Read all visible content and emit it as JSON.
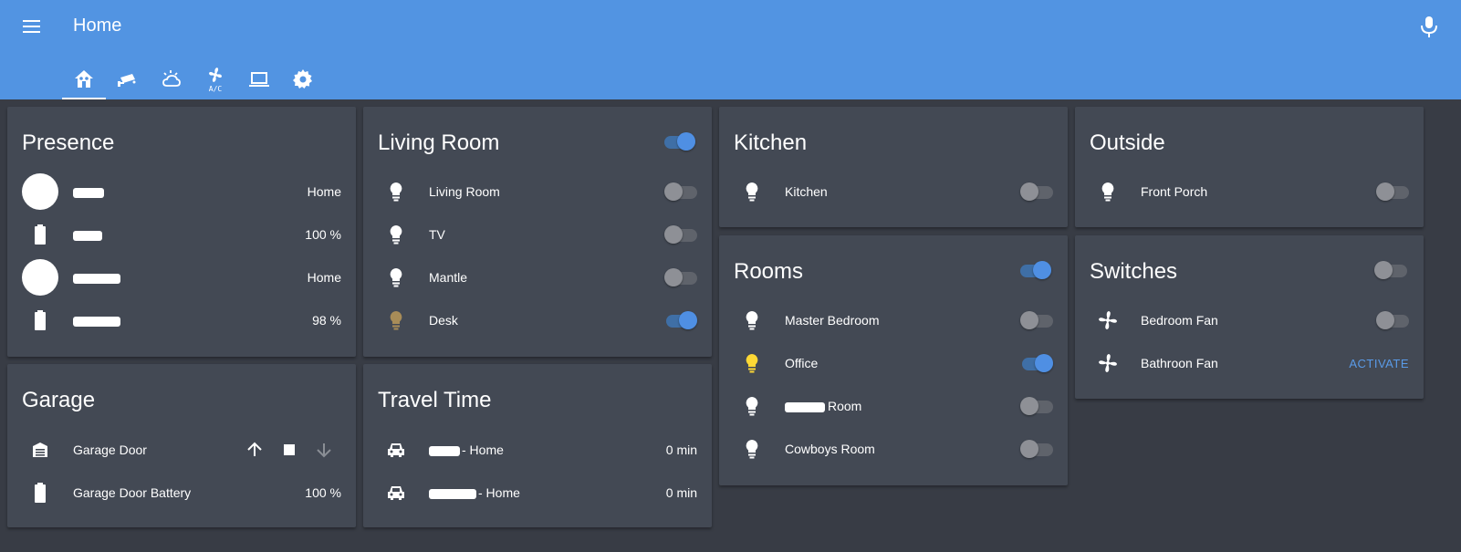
{
  "header": {
    "title": "Home",
    "tabs": [
      {
        "name": "home-icon"
      },
      {
        "name": "cctv-icon"
      },
      {
        "name": "weather-icon"
      },
      {
        "name": "ac-fan-icon",
        "label": "A/C"
      },
      {
        "name": "laptop-icon"
      },
      {
        "name": "gear-icon"
      }
    ]
  },
  "presence": {
    "title": "Presence",
    "rows": [
      {
        "value": "Home"
      },
      {
        "value": "100 %"
      },
      {
        "value": "Home"
      },
      {
        "value": "98 %"
      }
    ]
  },
  "garage": {
    "title": "Garage",
    "door_label": "Garage Door",
    "battery_label": "Garage Door Battery",
    "battery_value": "100 %"
  },
  "living_room": {
    "title": "Living Room",
    "header_toggle": true,
    "rows": [
      {
        "label": "Living Room",
        "on": false
      },
      {
        "label": "TV",
        "on": false
      },
      {
        "label": "Mantle",
        "on": false
      },
      {
        "label": "Desk",
        "on": true
      }
    ]
  },
  "travel_time": {
    "title": "Travel Time",
    "rows": [
      {
        "label": "- Home",
        "value": "0 min"
      },
      {
        "label": "- Home",
        "value": "0 min"
      }
    ]
  },
  "kitchen": {
    "title": "Kitchen",
    "rows": [
      {
        "label": "Kitchen",
        "on": false
      }
    ]
  },
  "rooms": {
    "title": "Rooms",
    "header_toggle": true,
    "rows": [
      {
        "label": "Master Bedroom",
        "on": false
      },
      {
        "label": "Office",
        "on": true
      },
      {
        "label": "Room",
        "on": false
      },
      {
        "label": "Cowboys Room",
        "on": false
      }
    ]
  },
  "outside": {
    "title": "Outside",
    "rows": [
      {
        "label": "Front Porch",
        "on": false
      }
    ]
  },
  "switches": {
    "title": "Switches",
    "header_toggle": false,
    "rows": [
      {
        "label": "Bedroom Fan",
        "on": false
      },
      {
        "label": "Bathroon Fan",
        "action": "ACTIVATE"
      }
    ]
  },
  "colors": {
    "header": "#5294e2",
    "background": "#383c45",
    "card": "#434954",
    "accent": "#4f8fe3",
    "bulb_on": "#fdd835",
    "bulb_dim": "#a88c58"
  }
}
